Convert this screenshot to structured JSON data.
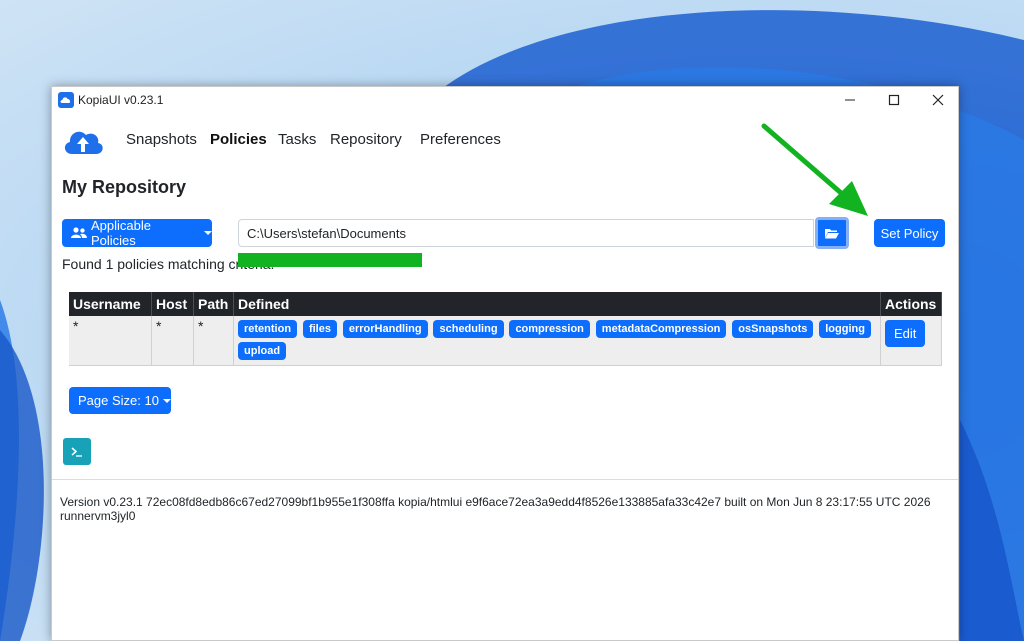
{
  "window": {
    "title": "KopiaUI v0.23.1"
  },
  "nav": {
    "items": [
      {
        "label": "Snapshots",
        "active": false
      },
      {
        "label": "Policies",
        "active": true
      },
      {
        "label": "Tasks",
        "active": false
      },
      {
        "label": "Repository",
        "active": false
      },
      {
        "label": "Preferences",
        "active": false
      }
    ]
  },
  "page": {
    "title": "My Repository",
    "applicable_label": "Applicable Policies",
    "path_value": "C:\\Users\\stefan\\Documents",
    "set_policy_label": "Set Policy",
    "found_text": "Found 1 policies matching criteria."
  },
  "table": {
    "headers": [
      "Username",
      "Host",
      "Path",
      "Defined",
      "Actions"
    ],
    "rows": [
      {
        "username": "*",
        "host": "*",
        "path": "*",
        "defined": [
          "retention",
          "files",
          "errorHandling",
          "scheduling",
          "compression",
          "metadataCompression",
          "osSnapshots",
          "logging",
          "upload"
        ],
        "action": "Edit"
      }
    ]
  },
  "pagination": {
    "page_size_label": "Page Size: 10"
  },
  "footer": {
    "version": "Version v0.23.1 72ec08fd8edb86c67ed27099bf1b955e1f308ffa kopia/htmlui e9f6ace72ea3a9edd4f8526e133885afa33c42e7 built on Mon Jun 8 23:17:55 UTC 2026 runnervm3jyl0"
  },
  "colors": {
    "accent": "#0d6efd",
    "table_header": "#212529",
    "annotation": "#12b320",
    "terminal": "#17a2b8"
  }
}
